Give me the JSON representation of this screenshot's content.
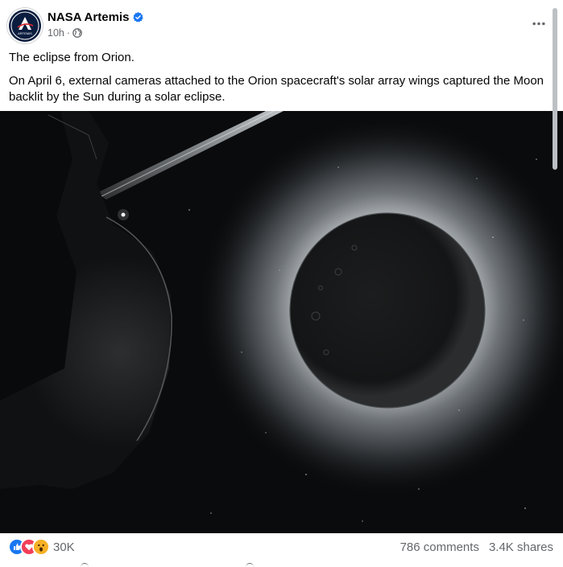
{
  "post": {
    "page_name": "NASA Artemis",
    "time": "10h",
    "separator": "·",
    "caption_line1": "The eclipse from Orion.",
    "caption_line2": "On April 6, external cameras attached to the Orion spacecraft's solar array wings captured the Moon backlit by the Sun during a solar eclipse.",
    "avatar_text": "ARTEMIS"
  },
  "icons": {
    "verified": "verified-badge-icon",
    "audience": "globe-icon",
    "more": "more-options-icon",
    "reactions": [
      "like-icon",
      "love-icon",
      "wow-icon"
    ]
  },
  "engagement": {
    "reactions_count": "30K",
    "comments": "786 comments",
    "shares": "3.4K shares"
  },
  "colors": {
    "verified": "#1877f2",
    "secondary_text": "#65676b",
    "like": "#1877f2",
    "love": "#f33e58",
    "wow": "#f7b125"
  }
}
